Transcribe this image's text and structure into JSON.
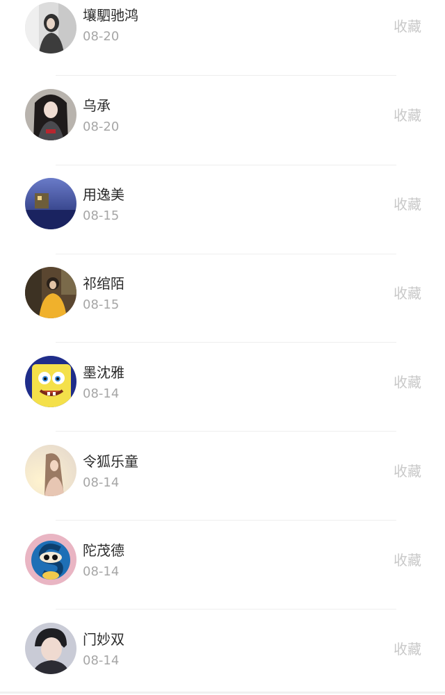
{
  "list": {
    "items": [
      {
        "name": "壤駟驰鸿",
        "date": "08-20",
        "action": "收藏",
        "avatar_icon": "avatar-photo-woman-grey",
        "avatar_colors": [
          "#d7d7d7",
          "#3a3a3a"
        ]
      },
      {
        "name": "乌承",
        "date": "08-20",
        "action": "收藏",
        "avatar_icon": "avatar-anime-character",
        "avatar_colors": [
          "#b9b5b0",
          "#2a2626"
        ]
      },
      {
        "name": "用逸美",
        "date": "08-15",
        "action": "收藏",
        "avatar_icon": "avatar-photo-blue-night",
        "avatar_colors": [
          "#2a3e8f",
          "#5b6bb8"
        ]
      },
      {
        "name": "祁绾陌",
        "date": "08-15",
        "action": "收藏",
        "avatar_icon": "avatar-photo-woman-yellow",
        "avatar_colors": [
          "#4d3a23",
          "#f0b12c"
        ]
      },
      {
        "name": "墨沈雅",
        "date": "08-14",
        "action": "收藏",
        "avatar_icon": "avatar-spongebob",
        "avatar_colors": [
          "#1f2d8a",
          "#f4e04a"
        ]
      },
      {
        "name": "令狐乐童",
        "date": "08-14",
        "action": "收藏",
        "avatar_icon": "avatar-photo-woman-sunlight",
        "avatar_colors": [
          "#f6e8d0",
          "#9a7a63"
        ]
      },
      {
        "name": "陀茂德",
        "date": "08-14",
        "action": "收藏",
        "avatar_icon": "avatar-cartoon-s",
        "avatar_colors": [
          "#e9b5c3",
          "#1e6fb6"
        ]
      },
      {
        "name": "门妙双",
        "date": "08-14",
        "action": "收藏",
        "avatar_icon": "avatar-photo-man-dark",
        "avatar_colors": [
          "#c9cbd6",
          "#1e1e22"
        ]
      }
    ]
  }
}
